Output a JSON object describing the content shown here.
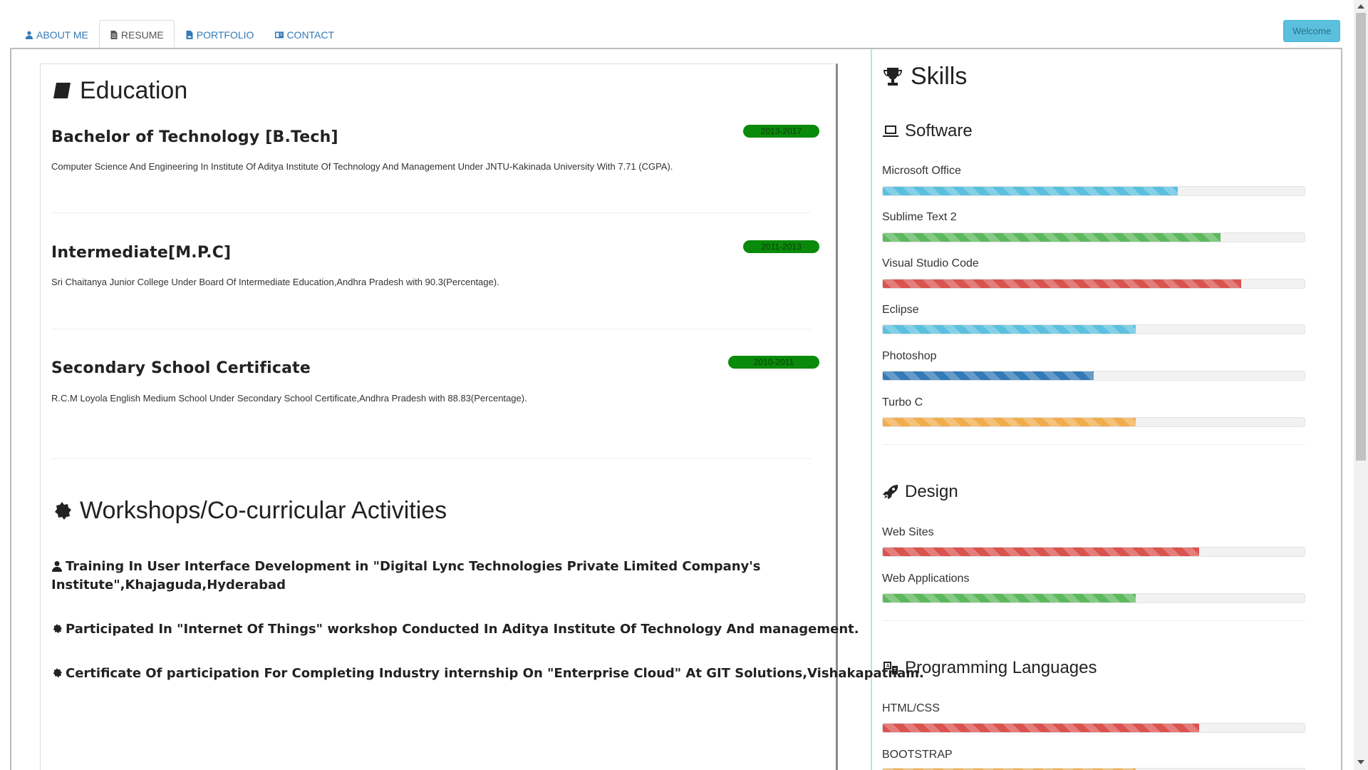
{
  "nav": {
    "tabs": [
      {
        "label": "ABOUT ME",
        "icon": "user-icon"
      },
      {
        "label": "RESUME",
        "icon": "document-icon"
      },
      {
        "label": "PORTFOLIO",
        "icon": "image-file-icon"
      },
      {
        "label": "CONTACT",
        "icon": "contact-card-icon"
      }
    ],
    "active_tab": "RESUME",
    "welcome_label": "Welcome"
  },
  "education": {
    "heading": "Education",
    "items": [
      {
        "title": "Bachelor of Technology [B.Tech]",
        "years": "2013-2017",
        "description": "Computer Science And Engineering In Institute Of Aditya Institute Of Technology And Management Under JNTU-Kakinada University With 7.71 (CGPA)."
      },
      {
        "title": "Intermediate[M.P.C]",
        "years": "2011-2013",
        "description": "Sri Chaitanya Junior College Under Board Of Intermediate Education,Andhra Pradesh with 90.3(Percentage)."
      },
      {
        "title": "Secondary School Certificate",
        "years": "2010-2011",
        "description": "R.C.M Loyola English Medium School Under Secondary School Certificate,Andhra Pradesh with 88.83(Percentage)."
      }
    ]
  },
  "workshops": {
    "heading": "Workshops/Co-curricular Activities",
    "items": [
      {
        "icon": "user-icon",
        "line1": "Training In User Interface Development in \"Digital Lync Technologies Private Limited Company's",
        "line2": "Institute\",Khajaguda,Hyderabad"
      },
      {
        "icon": "cog-icon",
        "line1": "Participated In \"Internet Of Things\" workshop Conducted In Aditya Institute Of Technology And management.",
        "line2": ""
      },
      {
        "icon": "cog-icon",
        "line1": "Certificate Of participation For Completing Industry internship On \"Enterprise Cloud\" At GIT Solutions,Vishakapatnam.",
        "line2": ""
      }
    ]
  },
  "skills": {
    "heading": "Skills",
    "software": {
      "heading": "Software",
      "items": [
        {
          "name": "Microsoft Office",
          "level": 0.7,
          "color": "#5bc0de"
        },
        {
          "name": "Sublime Text 2",
          "level": 0.8,
          "color": "#5cb85c"
        },
        {
          "name": "Visual Studio Code",
          "level": 0.85,
          "color": "#d9534f"
        },
        {
          "name": "Eclipse",
          "level": 0.6,
          "color": "#5bc0de"
        },
        {
          "name": "Photoshop",
          "level": 0.5,
          "color": "#337ab7"
        },
        {
          "name": "Turbo C",
          "level": 0.6,
          "color": "#f0ad4e"
        }
      ]
    },
    "design": {
      "heading": "Design",
      "items": [
        {
          "name": "Web Sites",
          "level": 0.75,
          "color": "#d9534f"
        },
        {
          "name": "Web Applications",
          "level": 0.6,
          "color": "#5cb85c"
        }
      ]
    },
    "programming": {
      "heading": "Programming Languages",
      "items": [
        {
          "name": "HTML/CSS",
          "level": 0.75,
          "color": "#d9534f"
        },
        {
          "name": "BOOTSTRAP",
          "level": 0.6,
          "color": "#f0ad4e"
        }
      ]
    }
  }
}
